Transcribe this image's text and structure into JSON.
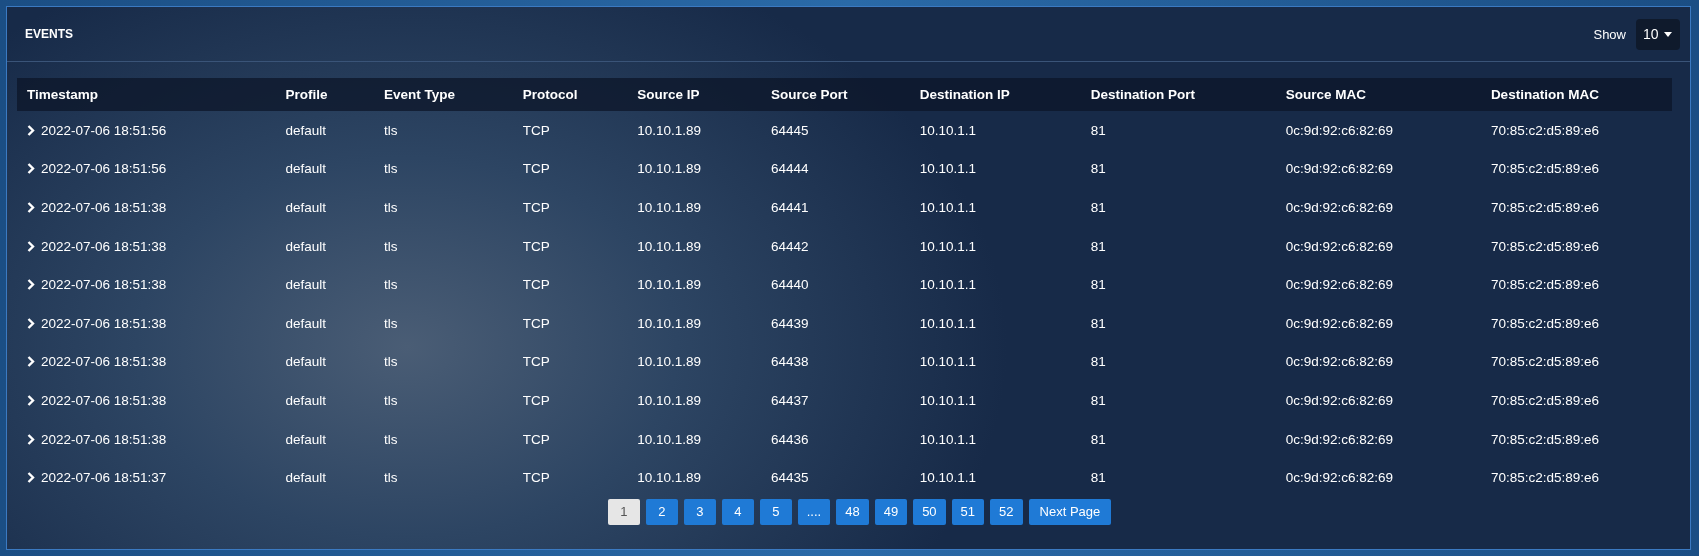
{
  "panel": {
    "title": "EVENTS",
    "show_label": "Show",
    "show_value": "10"
  },
  "table": {
    "columns": [
      "Timestamp",
      "Profile",
      "Event Type",
      "Protocol",
      "Source IP",
      "Source Port",
      "Destination IP",
      "Destination Port",
      "Source MAC",
      "Destination MAC"
    ],
    "rows": [
      {
        "expanded": false,
        "cells": [
          "2022-07-06 18:51:56",
          "default",
          "tls",
          "TCP",
          "10.10.1.89",
          "64445",
          "10.10.1.1",
          "81",
          "0c:9d:92:c6:82:69",
          "70:85:c2:d5:89:e6"
        ]
      },
      {
        "expanded": false,
        "cells": [
          "2022-07-06 18:51:56",
          "default",
          "tls",
          "TCP",
          "10.10.1.89",
          "64444",
          "10.10.1.1",
          "81",
          "0c:9d:92:c6:82:69",
          "70:85:c2:d5:89:e6"
        ]
      },
      {
        "expanded": false,
        "cells": [
          "2022-07-06 18:51:38",
          "default",
          "tls",
          "TCP",
          "10.10.1.89",
          "64441",
          "10.10.1.1",
          "81",
          "0c:9d:92:c6:82:69",
          "70:85:c2:d5:89:e6"
        ]
      },
      {
        "expanded": false,
        "cells": [
          "2022-07-06 18:51:38",
          "default",
          "tls",
          "TCP",
          "10.10.1.89",
          "64442",
          "10.10.1.1",
          "81",
          "0c:9d:92:c6:82:69",
          "70:85:c2:d5:89:e6"
        ]
      },
      {
        "expanded": false,
        "cells": [
          "2022-07-06 18:51:38",
          "default",
          "tls",
          "TCP",
          "10.10.1.89",
          "64440",
          "10.10.1.1",
          "81",
          "0c:9d:92:c6:82:69",
          "70:85:c2:d5:89:e6"
        ]
      },
      {
        "expanded": false,
        "cells": [
          "2022-07-06 18:51:38",
          "default",
          "tls",
          "TCP",
          "10.10.1.89",
          "64439",
          "10.10.1.1",
          "81",
          "0c:9d:92:c6:82:69",
          "70:85:c2:d5:89:e6"
        ]
      },
      {
        "expanded": false,
        "cells": [
          "2022-07-06 18:51:38",
          "default",
          "tls",
          "TCP",
          "10.10.1.89",
          "64438",
          "10.10.1.1",
          "81",
          "0c:9d:92:c6:82:69",
          "70:85:c2:d5:89:e6"
        ]
      },
      {
        "expanded": false,
        "cells": [
          "2022-07-06 18:51:38",
          "default",
          "tls",
          "TCP",
          "10.10.1.89",
          "64437",
          "10.10.1.1",
          "81",
          "0c:9d:92:c6:82:69",
          "70:85:c2:d5:89:e6"
        ]
      },
      {
        "expanded": false,
        "cells": [
          "2022-07-06 18:51:38",
          "default",
          "tls",
          "TCP",
          "10.10.1.89",
          "64436",
          "10.10.1.1",
          "81",
          "0c:9d:92:c6:82:69",
          "70:85:c2:d5:89:e6"
        ]
      },
      {
        "expanded": false,
        "cells": [
          "2022-07-06 18:51:37",
          "default",
          "tls",
          "TCP",
          "10.10.1.89",
          "64435",
          "10.10.1.1",
          "81",
          "0c:9d:92:c6:82:69",
          "70:85:c2:d5:89:e6"
        ]
      }
    ]
  },
  "pagination": {
    "pages": [
      {
        "label": "1",
        "selected": true
      },
      {
        "label": "2",
        "selected": false
      },
      {
        "label": "3",
        "selected": false
      },
      {
        "label": "4",
        "selected": false
      },
      {
        "label": "5",
        "selected": false
      },
      {
        "label": "....",
        "selected": false
      },
      {
        "label": "48",
        "selected": false
      },
      {
        "label": "49",
        "selected": false
      },
      {
        "label": "50",
        "selected": false
      },
      {
        "label": "51",
        "selected": false
      },
      {
        "label": "52",
        "selected": false
      }
    ],
    "next": "Next Page"
  }
}
